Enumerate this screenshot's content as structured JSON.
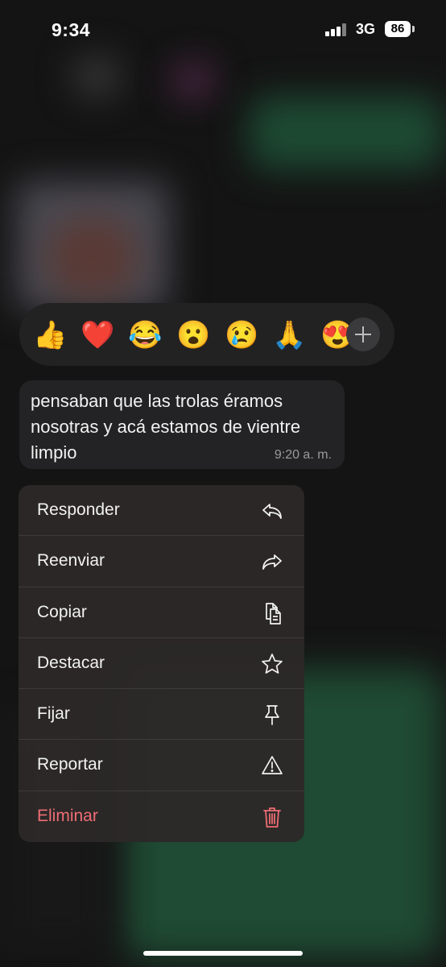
{
  "status_bar": {
    "time": "9:34",
    "network": "3G",
    "battery": "86"
  },
  "reactions": {
    "items": [
      {
        "emoji": "👍",
        "name": "thumbs-up"
      },
      {
        "emoji": "❤️",
        "name": "red-heart"
      },
      {
        "emoji": "😂",
        "name": "tears-of-joy"
      },
      {
        "emoji": "😮",
        "name": "surprised"
      },
      {
        "emoji": "😢",
        "name": "crying"
      },
      {
        "emoji": "🙏",
        "name": "folded-hands"
      },
      {
        "emoji": "😍",
        "name": "heart-eyes"
      }
    ],
    "add_icon": "plus-icon"
  },
  "message": {
    "text": "pensaban que las trolas éramos nosotras y acá estamos de vientre limpio",
    "time": "9:20 a. m."
  },
  "menu": {
    "items": [
      {
        "label": "Responder",
        "icon": "reply-icon"
      },
      {
        "label": "Reenviar",
        "icon": "forward-icon"
      },
      {
        "label": "Copiar",
        "icon": "copy-icon"
      },
      {
        "label": "Destacar",
        "icon": "star-icon"
      },
      {
        "label": "Fijar",
        "icon": "pin-icon"
      },
      {
        "label": "Reportar",
        "icon": "warning-icon"
      },
      {
        "label": "Eliminar",
        "icon": "trash-icon"
      }
    ],
    "danger_color": "#ee6d74"
  }
}
